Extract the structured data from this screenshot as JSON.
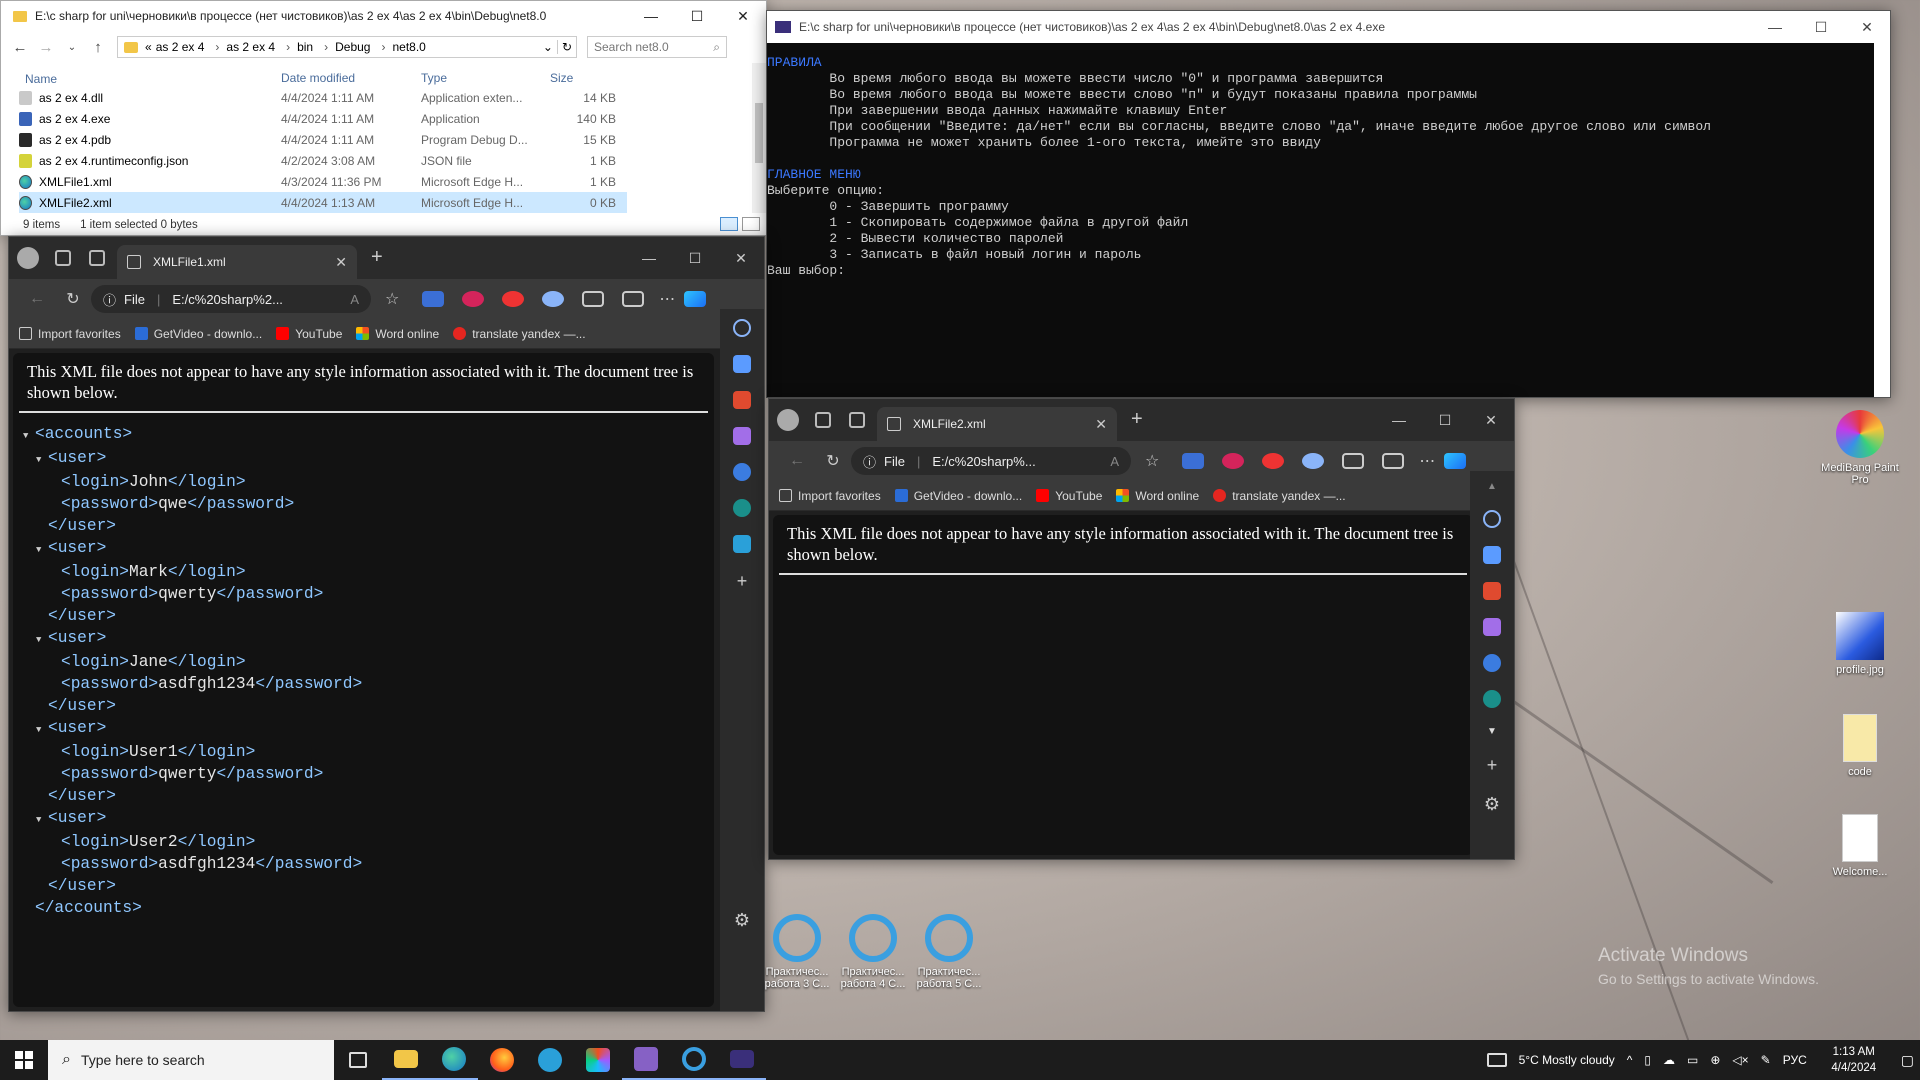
{
  "explorer": {
    "title": "E:\\c sharp for uni\\черновики\\в процессе (нет чистовиков)\\as 2 ex 4\\as 2 ex 4\\bin\\Debug\\net8.0",
    "breadcrumb": [
      "«",
      "as 2 ex 4",
      "as 2 ex 4",
      "bin",
      "Debug",
      "net8.0"
    ],
    "search_placeholder": "Search net8.0",
    "columns": [
      "Name",
      "Date modified",
      "Type",
      "Size"
    ],
    "files": [
      {
        "name": "as 2 ex 4.dll",
        "date": "4/4/2024 1:11 AM",
        "type": "Application exten...",
        "size": "14 KB",
        "icon": "dll-icon"
      },
      {
        "name": "as 2 ex 4.exe",
        "date": "4/4/2024 1:11 AM",
        "type": "Application",
        "size": "140 KB",
        "icon": "exe-icon"
      },
      {
        "name": "as 2 ex 4.pdb",
        "date": "4/4/2024 1:11 AM",
        "type": "Program Debug D...",
        "size": "15 KB",
        "icon": "pdb-icon"
      },
      {
        "name": "as 2 ex 4.runtimeconfig.json",
        "date": "4/2/2024 3:08 AM",
        "type": "JSON file",
        "size": "1 KB",
        "icon": "json-icon"
      },
      {
        "name": "XMLFile1.xml",
        "date": "4/3/2024 11:36 PM",
        "type": "Microsoft Edge H...",
        "size": "1 KB",
        "icon": "edge-icon"
      },
      {
        "name": "XMLFile2.xml",
        "date": "4/4/2024 1:13 AM",
        "type": "Microsoft Edge H...",
        "size": "0 KB",
        "icon": "edge-icon",
        "selected": true
      }
    ],
    "status_items": "9 items",
    "status_selected": "1 item selected  0 bytes"
  },
  "console": {
    "title": "E:\\c sharp for uni\\черновики\\в процессе (нет чистовиков)\\as 2 ex 4\\as 2 ex 4\\bin\\Debug\\net8.0\\as 2 ex 4.exe",
    "rules_heading": "ПРАВИЛА",
    "rules": [
      "        Во время любого ввода вы можете ввести число \"0\" и программа завершится",
      "        Во время любого ввода вы можете ввести слово \"п\" и будут показаны правила программы",
      "        При завершении ввода данных нажимайте клавишу Enter",
      "        При сообщении \"Введите: да/нет\" если вы согласны, введите слово \"да\", иначе введите любое другое слово или символ",
      "        Программа не может хранить более 1-ого текста, имейте это ввиду"
    ],
    "menu_heading": "ГЛАВНОЕ МЕНЮ",
    "menu_lines": [
      "Выберите опцию:",
      "        0 - Завершить программу",
      "        1 - Скопировать содержимое файла в другой файл",
      "        2 - Вывести количество паролей",
      "        3 - Записать в файл новый логин и пароль",
      "Ваш выбор:"
    ]
  },
  "edge1": {
    "tab_title": "XMLFile1.xml",
    "url_prefix": "File",
    "url": "E:/c%20sharp%2...",
    "notice": "This XML file does not appear to have any style information associated with it. The document tree is shown below.",
    "xml_lines": [
      {
        "indent": 0,
        "tri": true,
        "text": "<accounts>"
      },
      {
        "indent": 1,
        "tri": true,
        "text": "<user>"
      },
      {
        "indent": 2,
        "text": "<login>John</login>"
      },
      {
        "indent": 2,
        "text": "<password>qwe</password>"
      },
      {
        "indent": 1,
        "text": "</user>"
      },
      {
        "indent": 1,
        "tri": true,
        "text": "<user>"
      },
      {
        "indent": 2,
        "text": "<login>Mark</login>"
      },
      {
        "indent": 2,
        "text": "<password>qwerty</password>"
      },
      {
        "indent": 1,
        "text": "</user>"
      },
      {
        "indent": 1,
        "tri": true,
        "text": "<user>"
      },
      {
        "indent": 2,
        "text": "<login>Jane</login>"
      },
      {
        "indent": 2,
        "text": "<password>asdfgh1234</password>"
      },
      {
        "indent": 1,
        "text": "</user>"
      },
      {
        "indent": 1,
        "tri": true,
        "text": "<user>"
      },
      {
        "indent": 2,
        "text": "<login>User1</login>"
      },
      {
        "indent": 2,
        "text": "<password>qwerty</password>"
      },
      {
        "indent": 1,
        "text": "</user>"
      },
      {
        "indent": 1,
        "tri": true,
        "text": "<user>"
      },
      {
        "indent": 2,
        "text": "<login>User2</login>"
      },
      {
        "indent": 2,
        "text": "<password>asdfgh1234</password>"
      },
      {
        "indent": 1,
        "text": "</user>"
      },
      {
        "indent": 0,
        "text": "</accounts>"
      }
    ]
  },
  "edge2": {
    "tab_title": "XMLFile2.xml",
    "url_prefix": "File",
    "url": "E:/c%20sharp%...",
    "notice": "This XML file does not appear to have any style information associated with it. The document tree is shown below."
  },
  "bookmarks": [
    {
      "label": "Import favorites",
      "icon": "import-icon"
    },
    {
      "label": "GetVideo - downlo...",
      "icon": "getvideo-icon"
    },
    {
      "label": "YouTube",
      "icon": "youtube-icon"
    },
    {
      "label": "Word online",
      "icon": "windows-grid-icon"
    },
    {
      "label": "translate yandex —...",
      "icon": "yandex-icon"
    }
  ],
  "desktop_icons": [
    {
      "label": "MediBang Paint Pro",
      "name": "desktop-medibang"
    },
    {
      "label": "profile.jpg",
      "name": "desktop-profile-jpg"
    },
    {
      "label": "code",
      "name": "desktop-code-folder"
    },
    {
      "label": "Welcome...",
      "name": "desktop-welcome"
    },
    {
      "label": "Практичес... работа 3 С...",
      "name": "desktop-practice-3"
    },
    {
      "label": "Практичес... работа 4 С...",
      "name": "desktop-practice-4"
    },
    {
      "label": "Практичес... работа 5 С...",
      "name": "desktop-practice-5"
    }
  ],
  "watermark": {
    "line1": "Activate Windows",
    "line2": "Go to Settings to activate Windows."
  },
  "taskbar": {
    "search_placeholder": "Type here to search",
    "weather": "5°C  Mostly cloudy",
    "language": "РУС",
    "time": "1:13 AM",
    "date": "4/4/2024"
  },
  "colors": {
    "console_accent": "#3b78ff",
    "xml_tag": "#8fc7ff",
    "selection": "#cce8ff"
  }
}
